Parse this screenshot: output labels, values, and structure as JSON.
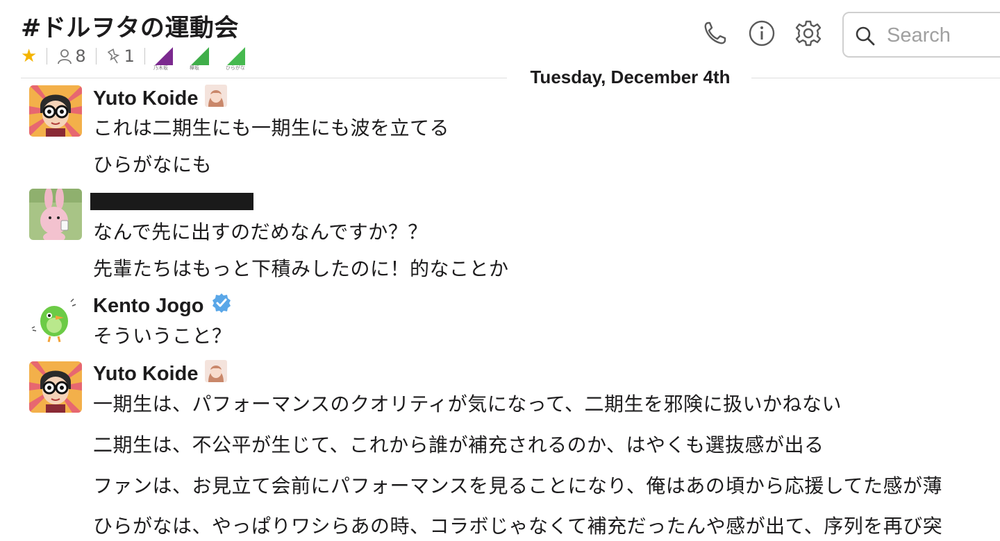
{
  "channel": {
    "title": "#ドルヲタの運動会",
    "members_count": "8",
    "pinned_count": "1",
    "groups": [
      {
        "label": "乃木坂",
        "color": "#7b2a8f"
      },
      {
        "label": "欅坂",
        "color": "#3fae49"
      },
      {
        "label": "ひらがな",
        "color": "#46b94f"
      }
    ]
  },
  "header_icons": [
    "phone-icon",
    "info-icon",
    "gear-icon"
  ],
  "search": {
    "placeholder": "Search"
  },
  "day_divider": "Tuesday, December 4th",
  "messages": [
    {
      "sender": "Yuto Koide",
      "lines": [
        "これは二期生にも一期生にも波を立てる",
        "ひらがなにも"
      ]
    },
    {
      "sender": "",
      "lines": [
        "なんで先に出すのだめなんですか？？",
        "先輩たちはもっと下積みしたのに！的なことか"
      ]
    },
    {
      "sender": "Kento Jogo",
      "lines": [
        "そういうこと？"
      ]
    },
    {
      "sender": "Yuto Koide",
      "lines": [
        "一期生は、パフォーマンスのクオリティが気になって、二期生を邪険に扱いかねない",
        "二期生は、不公平が生じて、これから誰が補充されるのか、はやくも選抜感が出る",
        "ファンは、お見立て会前にパフォーマンスを見ることになり、俺はあの頃から応援してた感が薄",
        "ひらがなは、やっぱりワシらあの時、コラボじゃなくて補充だったんや感が出て、序列を再び突"
      ]
    }
  ]
}
